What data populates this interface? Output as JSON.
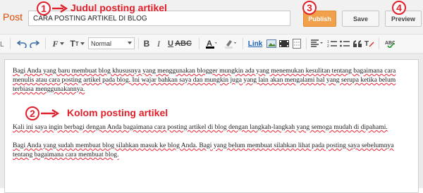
{
  "header": {
    "post_label": "Post",
    "title_value": "CARA POSTING ARTIKEL DI BLOG",
    "publish_label": "Publish",
    "save_label": "Save",
    "preview_label": "Preview"
  },
  "annotations": [
    {
      "number": "1",
      "text": "Judul posting artikel"
    },
    {
      "number": "2",
      "text": "Kolom posting artikel"
    },
    {
      "number": "3",
      "text": ""
    },
    {
      "number": "4",
      "text": ""
    }
  ],
  "toolbar": {
    "font_size_label": "T",
    "font_family_label": "F",
    "font_select_value": "Normal",
    "link_label": "Link"
  },
  "editor": {
    "paragraphs": [
      "Bagi Anda yang baru membuat blog khususnya yang menggunakan blogger mungkin ada yang menemukan kesulitan tentang bagaimana cara menulis atau cara posting artikel pada blog. Ini wajar bahkan saya dan mungkin juga yang lain akan mengalami hal yang serupa ketika belum terbiasa menggunakannya.",
      "Kali ini saya ingin berbagi dengan Anda bagaimana cara posting artikel di blog dengan langkah-langkah yang semoga mudah di dipahami.",
      "Bagi Anda yang sudah membuat blog silahkan masuk ke blog Anda. Bagi yang belum membuat silahkan lihat pada posting saya sebelumnya tentang bagaimana cara membuat blog."
    ]
  },
  "colors": {
    "annotation_red": "#e0202a",
    "publish_orange": "#f1a04b",
    "post_label_orange": "#dd4b00"
  }
}
